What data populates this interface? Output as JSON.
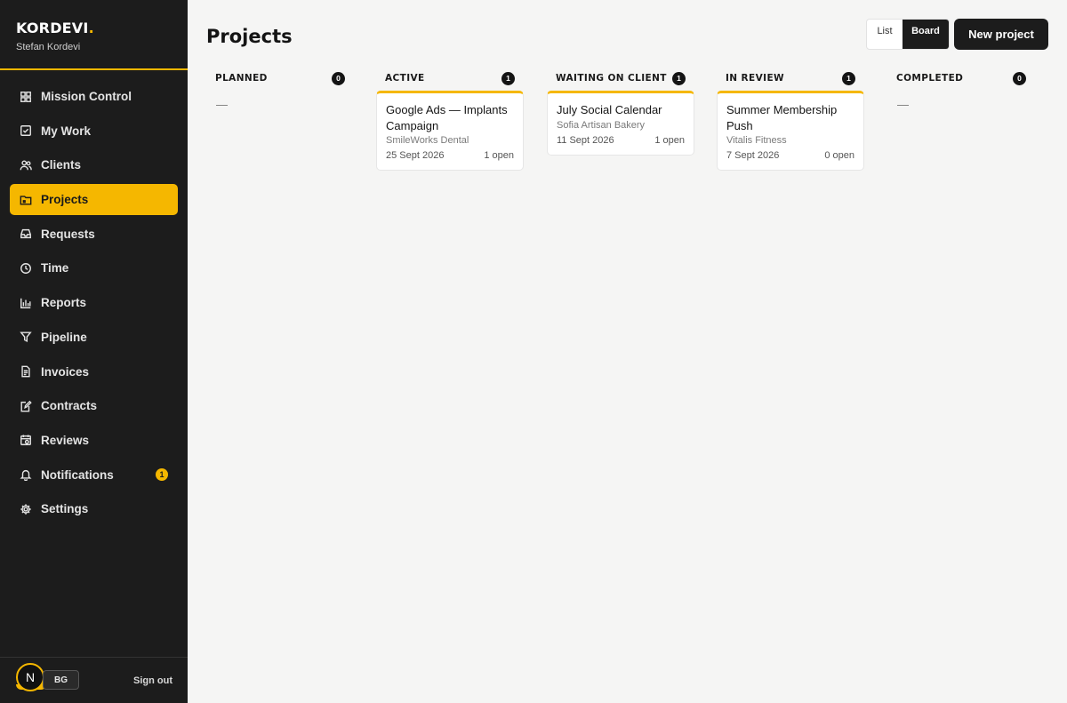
{
  "sidebar": {
    "logo_text": "KORDEVI",
    "logo_dot": ".",
    "user_name": "Stefan Kordevi",
    "items": [
      {
        "label": "Mission Control",
        "icon": "dashboard-icon"
      },
      {
        "label": "My Work",
        "icon": "check-square-icon"
      },
      {
        "label": "Clients",
        "icon": "users-icon"
      },
      {
        "label": "Projects",
        "icon": "folder-icon",
        "active": true
      },
      {
        "label": "Requests",
        "icon": "inbox-icon"
      },
      {
        "label": "Time",
        "icon": "clock-icon"
      },
      {
        "label": "Reports",
        "icon": "bar-chart-icon"
      },
      {
        "label": "Pipeline",
        "icon": "funnel-icon"
      },
      {
        "label": "Invoices",
        "icon": "document-icon"
      },
      {
        "label": "Contracts",
        "icon": "edit-document-icon"
      },
      {
        "label": "Reviews",
        "icon": "calendar-icon"
      },
      {
        "label": "Notifications",
        "icon": "bell-icon",
        "badge": "1"
      },
      {
        "label": "Settings",
        "icon": "gear-icon"
      }
    ],
    "footer": {
      "avatar_letter": "N",
      "language": "BG",
      "sign_out": "Sign out"
    }
  },
  "header": {
    "title": "Projects",
    "view_list": "List",
    "view_board": "Board",
    "new_project": "New project"
  },
  "board": {
    "columns": [
      {
        "title": "PLANNED",
        "count": "0",
        "empty": "—",
        "cards": []
      },
      {
        "title": "ACTIVE",
        "count": "1",
        "cards": [
          {
            "title": "Google Ads — Implants Campaign",
            "client": "SmileWorks Dental",
            "date": "25 Sept 2026",
            "open": "1 open"
          }
        ]
      },
      {
        "title": "WAITING ON CLIENT",
        "count": "1",
        "cards": [
          {
            "title": "July Social Calendar",
            "client": "Sofia Artisan Bakery",
            "date": "11 Sept 2026",
            "open": "1 open"
          }
        ]
      },
      {
        "title": "IN REVIEW",
        "count": "1",
        "cards": [
          {
            "title": "Summer Membership Push",
            "client": "Vitalis Fitness",
            "date": "7 Sept 2026",
            "open": "0 open"
          }
        ]
      },
      {
        "title": "COMPLETED",
        "count": "0",
        "empty": "—",
        "cards": []
      }
    ]
  },
  "colors": {
    "accent": "#f5b700",
    "sidebar_bg": "#1c1c1c",
    "page_bg": "#f5f5f4"
  }
}
